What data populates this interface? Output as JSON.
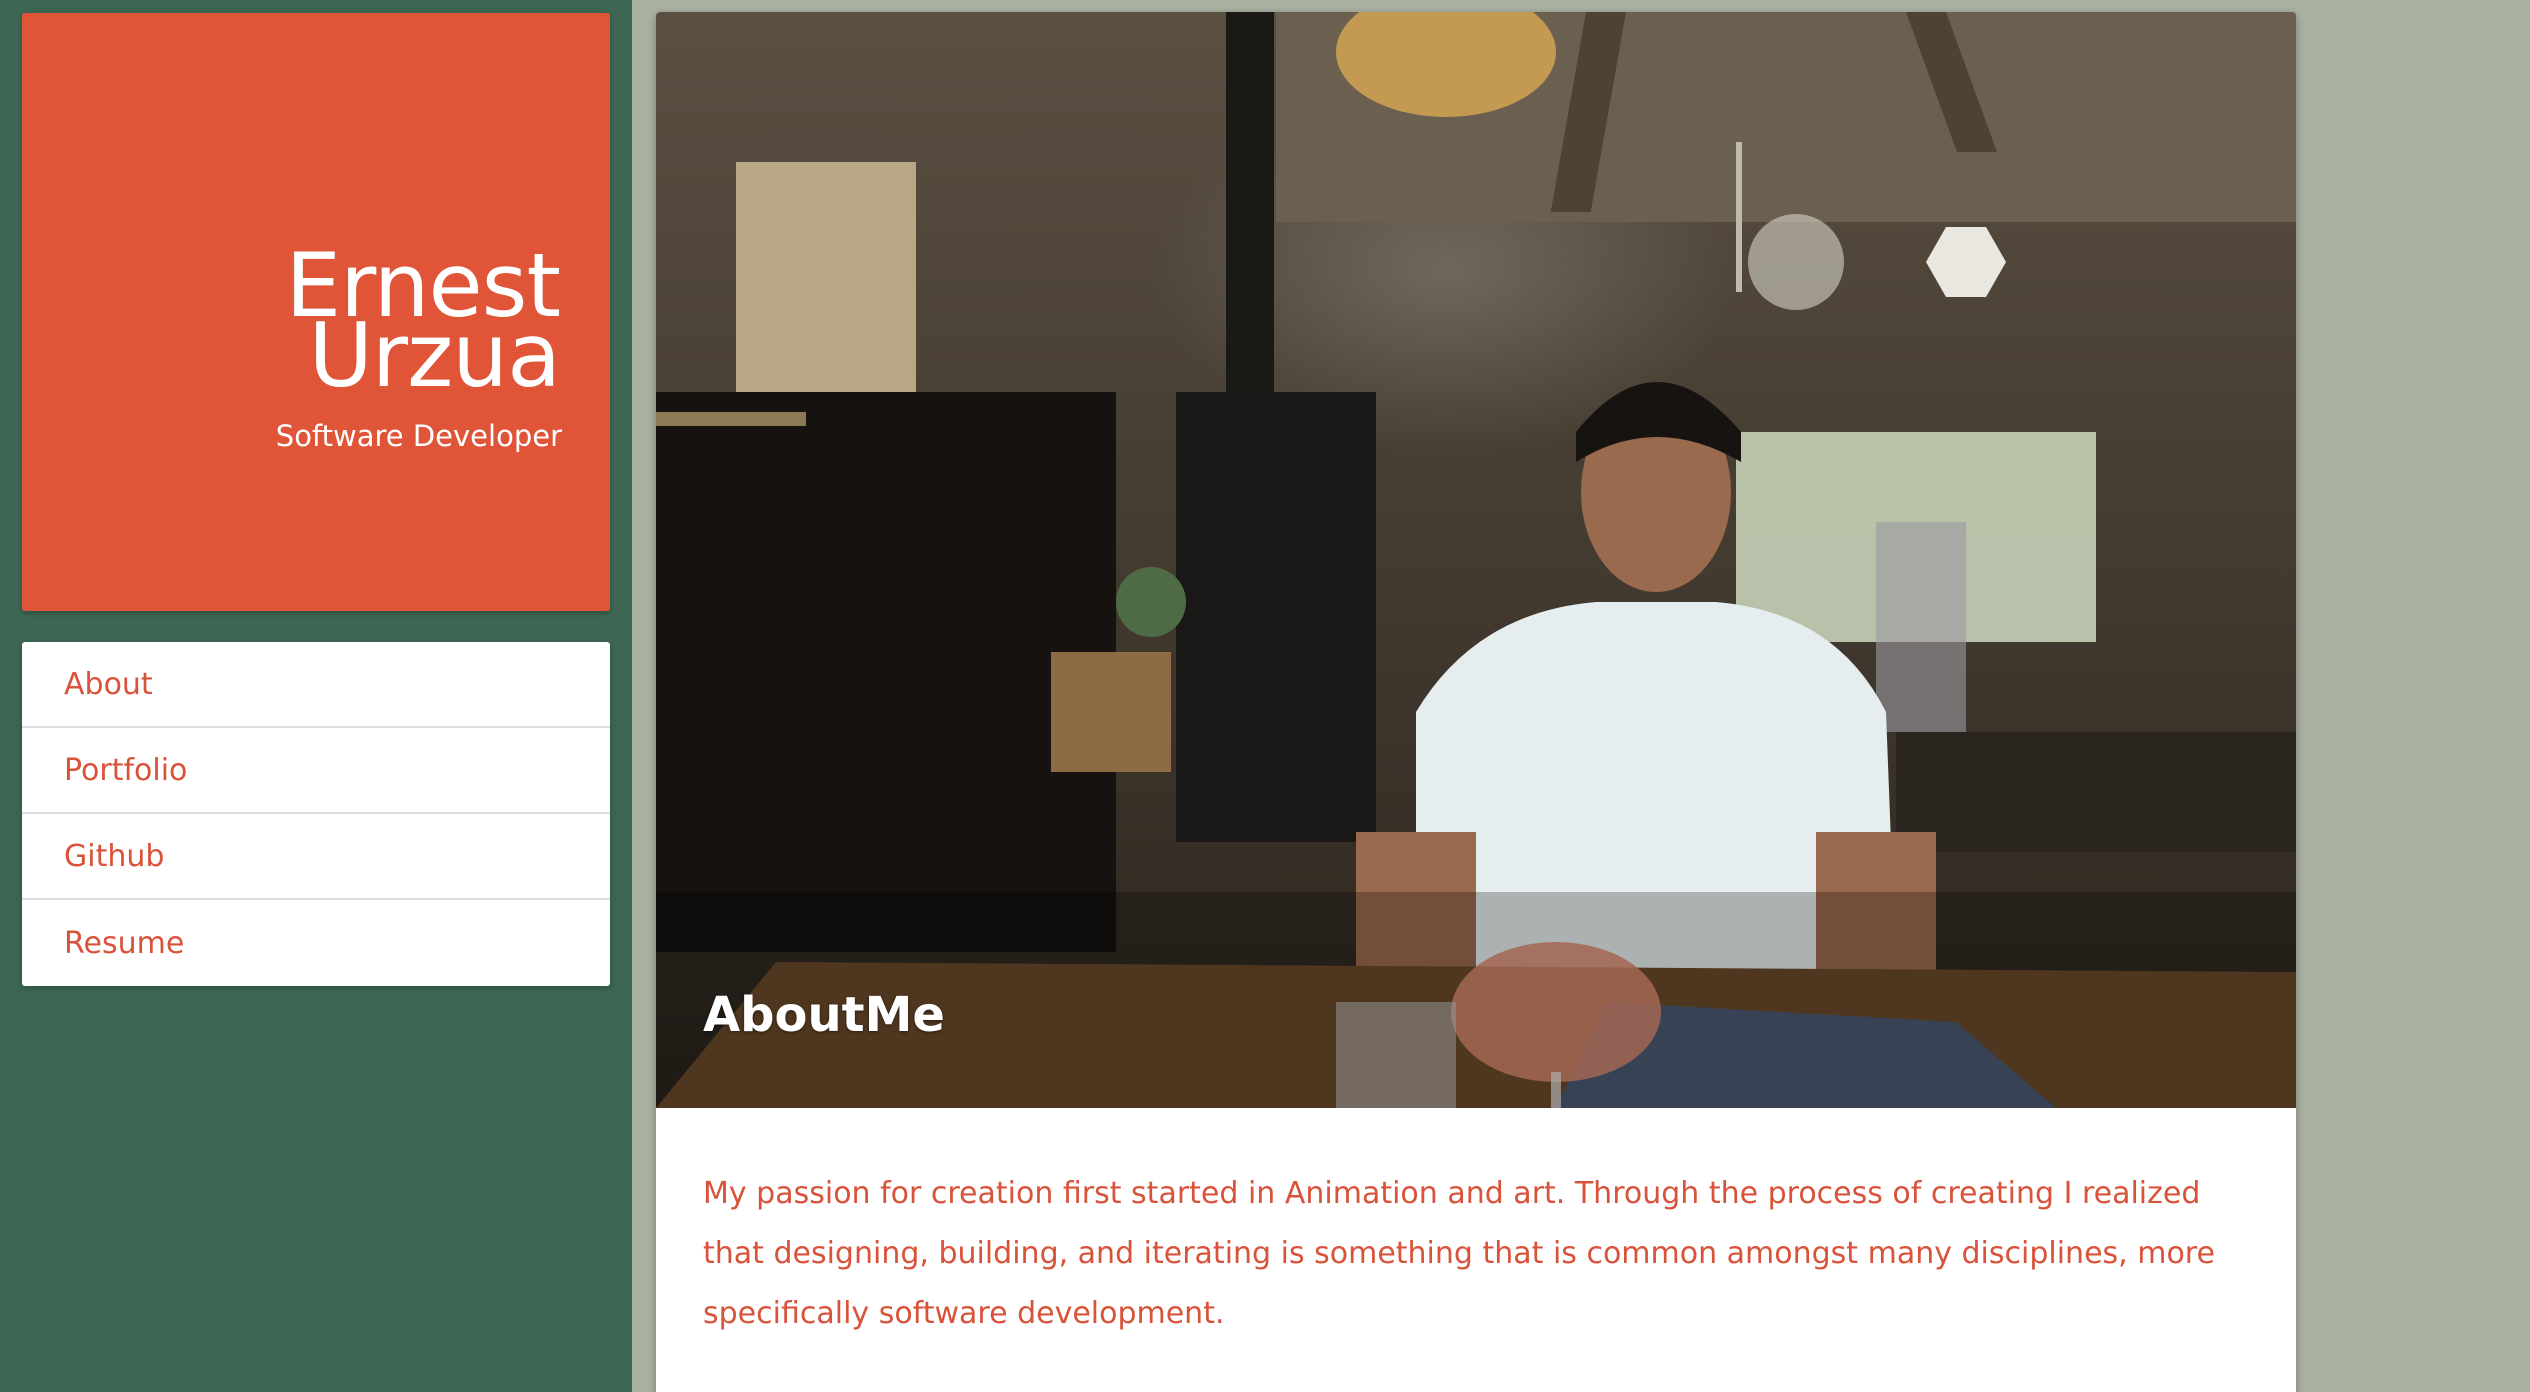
{
  "brand": {
    "first_name": "Ernest",
    "last_name": "Urzua",
    "subtitle": "Software Developer",
    "accent_color": "#e05538"
  },
  "nav": {
    "items": [
      {
        "label": "About"
      },
      {
        "label": "Portfolio"
      },
      {
        "label": "Github"
      },
      {
        "label": "Resume"
      }
    ]
  },
  "about": {
    "title": "AboutMe",
    "text": "My passion for creation first started in Animation and art. Through the process of creating I realized that designing, building, and iterating is something that is common amongst many disciplines, more specifically software development."
  },
  "colors": {
    "sidebar_bg": "#3d6752",
    "page_bg": "#a9b1a2",
    "link_color": "#d9533a"
  }
}
